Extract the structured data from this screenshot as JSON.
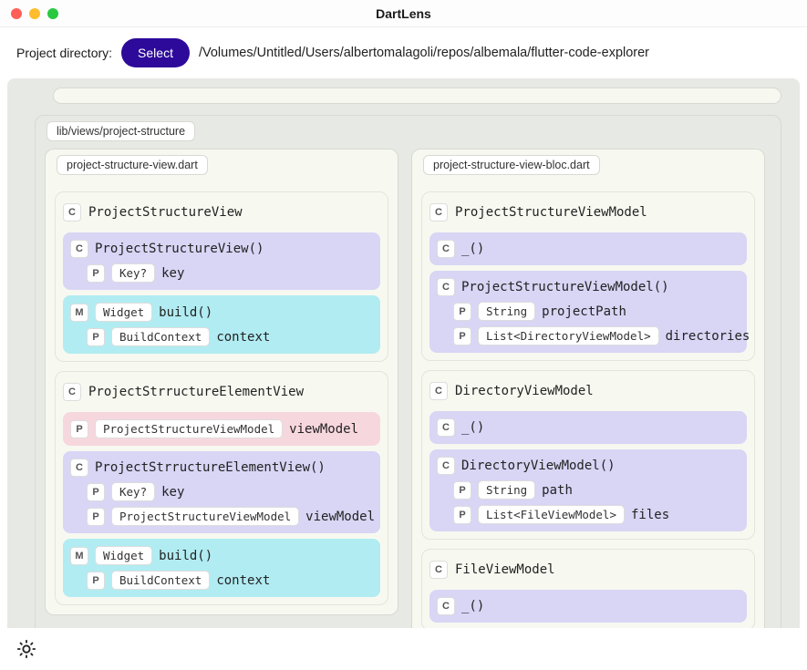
{
  "app": {
    "title": "DartLens"
  },
  "header": {
    "label": "Project directory:",
    "select_button": "Select",
    "path": "/Volumes/Untitled/Users/albertomalagoli/repos/albemala/flutter-code-explorer"
  },
  "directory": {
    "path": "lib/views/project-structure",
    "files": [
      {
        "name": "project-structure-view.dart",
        "classes": [
          {
            "badge": "C",
            "name": "ProjectStructureView",
            "members": [
              {
                "kind": "constructor",
                "badge": "C",
                "color": "lavender",
                "signature": "ProjectStructureView()",
                "params": [
                  {
                    "badge": "P",
                    "type": "Key?",
                    "name": "key"
                  }
                ]
              },
              {
                "kind": "method",
                "badge": "M",
                "color": "cyan",
                "returnType": "Widget",
                "signature": "build()",
                "params": [
                  {
                    "badge": "P",
                    "type": "BuildContext",
                    "name": "context"
                  }
                ]
              }
            ]
          },
          {
            "badge": "C",
            "name": "ProjectStrructureElementView",
            "members": [
              {
                "kind": "property",
                "badge": "P",
                "color": "pink",
                "type": "ProjectStructureViewModel",
                "name": "viewModel"
              },
              {
                "kind": "constructor",
                "badge": "C",
                "color": "lavender",
                "signature": "ProjectStrructureElementView()",
                "params": [
                  {
                    "badge": "P",
                    "type": "Key?",
                    "name": "key"
                  },
                  {
                    "badge": "P",
                    "type": "ProjectStructureViewModel",
                    "name": "viewModel"
                  }
                ]
              },
              {
                "kind": "method",
                "badge": "M",
                "color": "cyan",
                "returnType": "Widget",
                "signature": "build()",
                "params": [
                  {
                    "badge": "P",
                    "type": "BuildContext",
                    "name": "context"
                  }
                ]
              }
            ]
          }
        ]
      },
      {
        "name": "project-structure-view-bloc.dart",
        "classes": [
          {
            "badge": "C",
            "name": "ProjectStructureViewModel",
            "members": [
              {
                "kind": "constructor",
                "badge": "C",
                "color": "lavender",
                "signature": "_()",
                "params": []
              },
              {
                "kind": "constructor",
                "badge": "C",
                "color": "lavender",
                "signature": "ProjectStructureViewModel()",
                "params": [
                  {
                    "badge": "P",
                    "type": "String",
                    "name": "projectPath"
                  },
                  {
                    "badge": "P",
                    "type": "List<DirectoryViewModel>",
                    "name": "directories"
                  }
                ]
              }
            ]
          },
          {
            "badge": "C",
            "name": "DirectoryViewModel",
            "members": [
              {
                "kind": "constructor",
                "badge": "C",
                "color": "lavender",
                "signature": "_()",
                "params": []
              },
              {
                "kind": "constructor",
                "badge": "C",
                "color": "lavender",
                "signature": "DirectoryViewModel()",
                "params": [
                  {
                    "badge": "P",
                    "type": "String",
                    "name": "path"
                  },
                  {
                    "badge": "P",
                    "type": "List<FileViewModel>",
                    "name": "files"
                  }
                ]
              }
            ]
          },
          {
            "badge": "C",
            "name": "FileViewModel",
            "members": [
              {
                "kind": "constructor",
                "badge": "C",
                "color": "lavender",
                "signature": "_()",
                "params": []
              }
            ]
          }
        ]
      }
    ]
  }
}
